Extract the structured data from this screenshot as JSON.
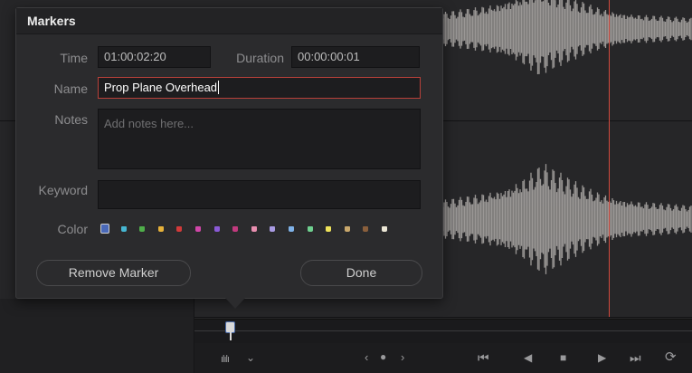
{
  "dialog": {
    "title": "Markers",
    "time_label": "Time",
    "time_value": "01:00:02:20",
    "duration_label": "Duration",
    "duration_value": "00:00:00:01",
    "name_label": "Name",
    "name_value": "Prop Plane Overhead",
    "notes_label": "Notes",
    "notes_placeholder": "Add notes here...",
    "keyword_label": "Keyword",
    "keyword_value": "",
    "color_label": "Color",
    "colors": [
      {
        "name": "blue",
        "hex": "#4a69b8",
        "selected": true
      },
      {
        "name": "cyan",
        "hex": "#46b6d1",
        "selected": false
      },
      {
        "name": "green",
        "hex": "#4fae4a",
        "selected": false
      },
      {
        "name": "yellow",
        "hex": "#e6b13a",
        "selected": false
      },
      {
        "name": "red",
        "hex": "#d23a3a",
        "selected": false
      },
      {
        "name": "pink",
        "hex": "#d046a8",
        "selected": false
      },
      {
        "name": "purple",
        "hex": "#8a5ad6",
        "selected": false
      },
      {
        "name": "fuchsia",
        "hex": "#c23a7e",
        "selected": false
      },
      {
        "name": "rose",
        "hex": "#e98fb0",
        "selected": false
      },
      {
        "name": "lavender",
        "hex": "#a99be3",
        "selected": false
      },
      {
        "name": "sky",
        "hex": "#7fb2e8",
        "selected": false
      },
      {
        "name": "mint",
        "hex": "#6fd08f",
        "selected": false
      },
      {
        "name": "lemon",
        "hex": "#efe35a",
        "selected": false
      },
      {
        "name": "sand",
        "hex": "#c9a86c",
        "selected": false
      },
      {
        "name": "cocoa",
        "hex": "#8a5f3c",
        "selected": false
      },
      {
        "name": "cream",
        "hex": "#ece7d6",
        "selected": false
      }
    ],
    "remove_label": "Remove Marker",
    "done_label": "Done"
  },
  "transport": {
    "audio_icon": "waveform-icon",
    "prev_icon": "chevron-left-icon",
    "next_icon": "chevron-right-icon",
    "buttons": [
      "skip-to-start-icon",
      "play-reverse-icon",
      "stop-icon",
      "play-icon",
      "skip-to-end-icon",
      "loop-icon"
    ]
  },
  "colors": {
    "playhead": "#d34a3e",
    "active_field_border": "#b9413a",
    "waveform": "#9a9795"
  }
}
